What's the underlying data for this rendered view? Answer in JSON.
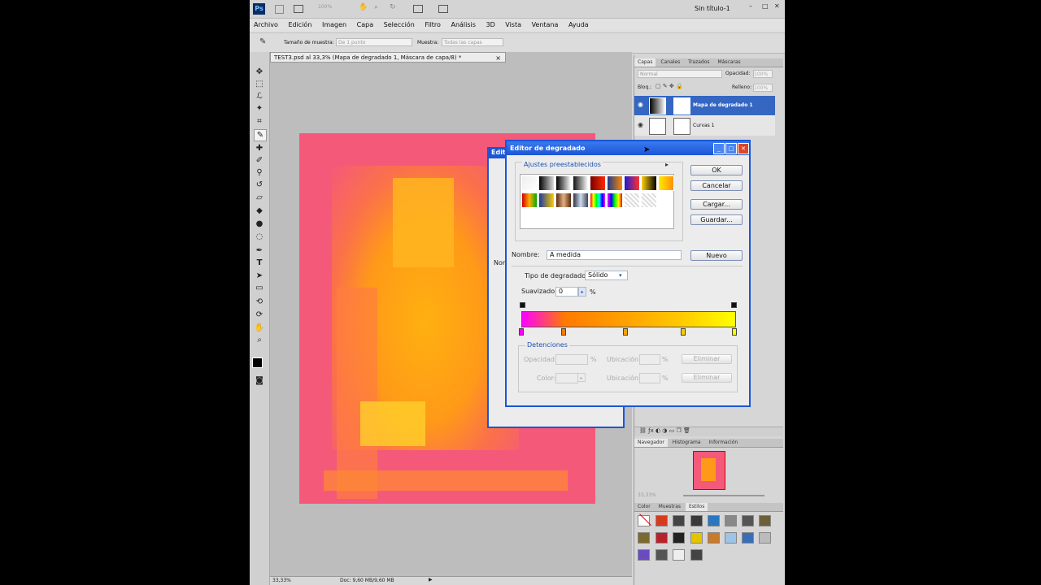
{
  "app": {
    "logo": "Ps",
    "zoom": "100%",
    "window_title": "Sin título-1",
    "menu": [
      "Archivo",
      "Edición",
      "Imagen",
      "Capa",
      "Selección",
      "Filtro",
      "Análisis",
      "3D",
      "Vista",
      "Ventana",
      "Ayuda"
    ]
  },
  "options": {
    "sample_size_label": "Tamaño de muestra:",
    "sample_size_value": "De 1 punto",
    "sample_label": "Muestra:",
    "sample_value": "Todas las capas"
  },
  "document": {
    "tab_title": "TEST3.psd al 33,3% (Mapa de degradado 1, Máscara de capa/8) *",
    "close": "×",
    "zoom_status": "33,33%",
    "doc_status": "Doc: 9,60 MB/9,60 MB"
  },
  "layers_panel": {
    "tabs": [
      "Capas",
      "Canales",
      "Trazados",
      "Máscaras"
    ],
    "blend_mode": "Normal",
    "opacity_label": "Opacidad:",
    "opacity_value": "100%",
    "lock_label": "Bloq.:",
    "fill_label": "Relleno:",
    "fill_value": "100%",
    "layers": [
      {
        "name": "Mapa de degradado 1",
        "selected": true
      },
      {
        "name": "Curvas 1",
        "selected": false
      }
    ]
  },
  "navigator_panel": {
    "tabs": [
      "Navegador",
      "Histograma",
      "Información"
    ],
    "zoom": "33,33%"
  },
  "styles_panel": {
    "tabs": [
      "Color",
      "Muestras",
      "Estilos"
    ],
    "active_tab": "Estilos"
  },
  "behind_dialog": {
    "title": "Editor",
    "label": "Nom"
  },
  "gradient_editor": {
    "title": "Editor de degradado",
    "presets_label": "Ajustes preestablecidos",
    "ok": "OK",
    "cancel": "Cancelar",
    "load": "Cargar...",
    "save": "Guardar...",
    "name_label": "Nombre:",
    "name_value": "A medida",
    "new_button": "Nuevo",
    "type_label": "Tipo de degradado:",
    "type_value": "Sólido",
    "smooth_label": "Suavizado:",
    "smooth_value": "0",
    "percent": "%",
    "stops_group": "Detenciones",
    "opacity_label": "Opacidad:",
    "location_label": "Ubicación:",
    "delete_label": "Eliminar",
    "color_label": "Color:",
    "gradient_colors": [
      "#ff00ff",
      "#ff7a00",
      "#ffa200",
      "#ffcc00",
      "#ffff00"
    ],
    "stop_positions": [
      0,
      20,
      49,
      76,
      100
    ]
  },
  "colors": {
    "dialog_title_blue": "#1b56d6",
    "selected_layer": "#3466c2",
    "canvas_pink": "#f5597a",
    "canvas_orange": "#ff9a18"
  }
}
